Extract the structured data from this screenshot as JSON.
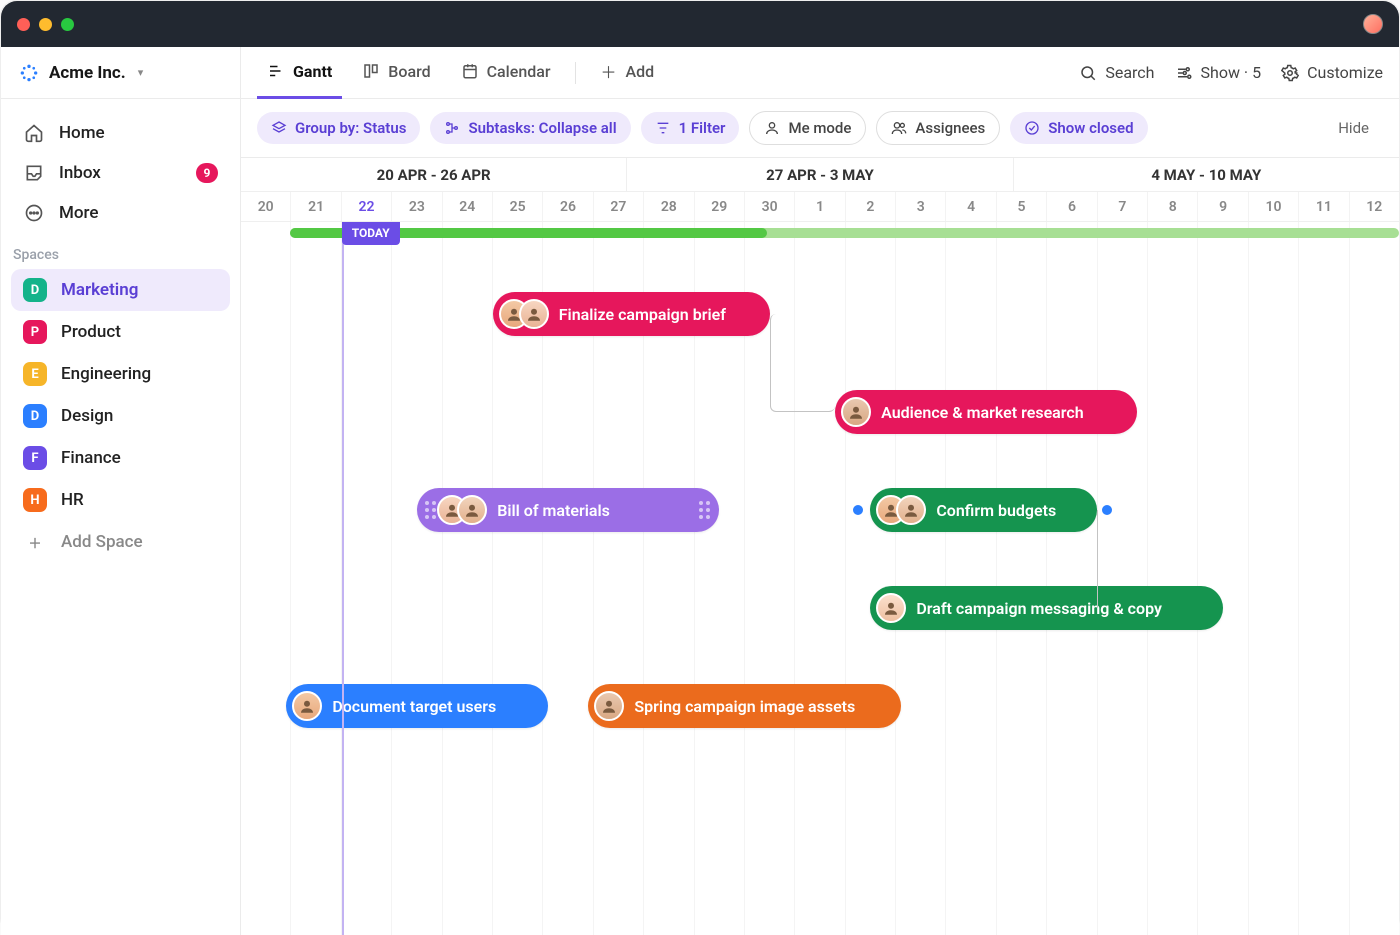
{
  "workspace": {
    "name": "Acme Inc."
  },
  "profile": {
    "avatar_initial": ""
  },
  "sidebar": {
    "nav": {
      "home_label": "Home",
      "inbox_label": "Inbox",
      "inbox_count": "9",
      "more_label": "More"
    },
    "spaces_title": "Spaces",
    "spaces": [
      {
        "letter": "D",
        "label": "Marketing",
        "color": "#14b38a",
        "active": true
      },
      {
        "letter": "P",
        "label": "Product",
        "color": "#e6175c"
      },
      {
        "letter": "E",
        "label": "Engineering",
        "color": "#f6b529"
      },
      {
        "letter": "D",
        "label": "Design",
        "color": "#2b7fff"
      },
      {
        "letter": "F",
        "label": "Finance",
        "color": "#6b4de6"
      },
      {
        "letter": "H",
        "label": "HR",
        "color": "#f76b1c"
      }
    ],
    "add_space_label": "Add Space"
  },
  "views": {
    "tabs": [
      {
        "label": "Gantt",
        "active": true
      },
      {
        "label": "Board"
      },
      {
        "label": "Calendar"
      }
    ],
    "add_label": "Add",
    "right": {
      "search_label": "Search",
      "show_label": "Show · 5",
      "customize_label": "Customize"
    }
  },
  "filters": {
    "group_by": "Group by: Status",
    "subtasks": "Subtasks: Collapse all",
    "filter_count": "1 Filter",
    "me_mode": "Me mode",
    "assignees": "Assignees",
    "show_closed": "Show closed",
    "hide": "Hide"
  },
  "timeline": {
    "ranges": [
      "20 APR - 26 APR",
      "27 APR - 3 MAY",
      "4 MAY - 10 MAY"
    ],
    "days": [
      "20",
      "21",
      "22",
      "23",
      "24",
      "25",
      "26",
      "27",
      "28",
      "29",
      "30",
      "1",
      "2",
      "3",
      "4",
      "5",
      "6",
      "7",
      "8",
      "9",
      "10",
      "11",
      "12"
    ],
    "today_index": 2,
    "today_label": "TODAY",
    "progress_start": 0.042,
    "progress_filled_to": 0.43
  },
  "tasks": [
    {
      "label": "Finalize campaign brief",
      "color": "#e6175c",
      "row": 0,
      "start": 5,
      "span": 5.5,
      "avatars": [
        "skin1",
        "skin2"
      ]
    },
    {
      "label": "Audience & market research",
      "color": "#e6175c",
      "row": 1,
      "start": 11.8,
      "span": 6,
      "avatars": [
        "skin3"
      ]
    },
    {
      "label": "Bill of materials",
      "color": "#9b6ee6",
      "row": 2,
      "start": 3.5,
      "span": 6,
      "avatars": [
        "skin2",
        "skin4"
      ],
      "handles": true
    },
    {
      "label": "Confirm budgets",
      "color": "#15944f",
      "row": 2,
      "start": 12.5,
      "span": 4.5,
      "avatars": [
        "skin1",
        "skin4"
      ],
      "milestones": true
    },
    {
      "label": "Draft campaign messaging & copy",
      "color": "#15944f",
      "row": 3,
      "start": 12.5,
      "span": 7,
      "avatars": [
        "skin5"
      ]
    },
    {
      "label": "Document target users",
      "color": "#2b7fff",
      "row": 4,
      "start": 0.9,
      "span": 5.2,
      "avatars": [
        "skin1"
      ]
    },
    {
      "label": "Spring campaign image assets",
      "color": "#eb6b1d",
      "row": 4,
      "start": 6.9,
      "span": 6.2,
      "avatars": [
        "skin3"
      ]
    }
  ]
}
